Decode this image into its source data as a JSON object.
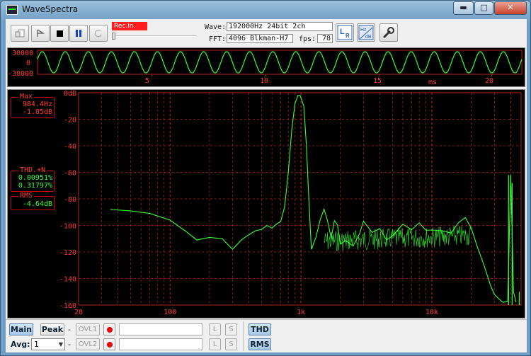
{
  "window": {
    "title": "WaveSpectra",
    "minimize": "▬",
    "maximize": "□",
    "close": "✕"
  },
  "toolbar": {
    "rec_label": "Rec.In.",
    "wave_label": "Wave:",
    "wave_value": "192000Hz 24bit 2ch",
    "fft_label": "FFT:",
    "fft_value": "4096 Blkman-H7",
    "fps_label": "fps:",
    "fps_value": "78",
    "lr_label": "LR",
    "hz_label": "Hz dB"
  },
  "wave": {
    "y_ticks": [
      "30000",
      "0",
      "-30000"
    ],
    "x_ticks": [
      "5",
      "10",
      "15",
      "20"
    ],
    "x_unit": "ms",
    "cycles": 21,
    "line_color": "#38ff38"
  },
  "spectrum": {
    "y_ticks": [
      "0dB",
      "-20",
      "-40",
      "-60",
      "-80",
      "-100",
      "-120",
      "-140",
      "-160"
    ],
    "x_ticks": [
      "20",
      "100",
      "1k",
      "10k"
    ],
    "line_color": "#38ff38",
    "grid_color": "#b22222"
  },
  "readouts": {
    "max_title": "Max",
    "max_freq": "984.4Hz",
    "max_level": "-1.85dB",
    "thd_title": "THD.+N",
    "thd_1": "0.00951%",
    "thd_2": "0.31797%",
    "rms_title": "RMS",
    "rms_value": "-4.64dB"
  },
  "bottom": {
    "main_btn": "Main",
    "peak_btn": "Peak",
    "dash1": "-",
    "ovl1": "OVL1",
    "avg_label": "Avg:",
    "avg_value": "1",
    "dash2": "-",
    "ovl2": "OVL2",
    "l_btn": "L",
    "s_btn": "S",
    "thd_btn": "THD",
    "rms_btn": "RMS"
  },
  "chart_data": [
    {
      "type": "line",
      "x": [
        0,
        1,
        2,
        3,
        4,
        5,
        6,
        7,
        8,
        9,
        10,
        11,
        12,
        13,
        14,
        15,
        16,
        17,
        18,
        19,
        20,
        21
      ],
      "ylim": [
        -30000,
        30000
      ],
      "xlabel": "ms",
      "series": [
        {
          "values": [
            0,
            0,
            0,
            0,
            0,
            0,
            0,
            0,
            0,
            0,
            0,
            0,
            0,
            0,
            0,
            0,
            0,
            0,
            0,
            0,
            0,
            0
          ]
        }
      ],
      "x_ticks": [
        5,
        10,
        15,
        20
      ],
      "y_ticks": [
        30000,
        0,
        -30000
      ]
    },
    {
      "type": "line",
      "xscale": "log",
      "xlim": [
        20,
        48000
      ],
      "ylim": [
        -160,
        0
      ],
      "x_ticks": [
        20,
        100,
        1000,
        10000
      ],
      "y_ticks": [
        0,
        -20,
        -40,
        -60,
        -80,
        -100,
        -120,
        -140,
        -160
      ],
      "x": [
        35,
        50,
        70,
        100,
        130,
        160,
        200,
        250,
        300,
        350,
        400,
        450,
        500,
        550,
        600,
        650,
        700,
        750,
        800,
        850,
        900,
        950,
        984,
        1050,
        1100,
        1150,
        1200,
        1300,
        1400,
        1500,
        1600,
        1700,
        1800,
        1900,
        2000,
        2200,
        2500,
        2800,
        3000,
        3500,
        4000,
        4500,
        5000,
        6000,
        7000,
        8000,
        9000,
        10000,
        12000,
        14000,
        16000,
        18000,
        20000,
        22000,
        25000,
        28000,
        30000,
        33000,
        35000,
        38000,
        40000,
        42000,
        44000
      ],
      "series": [
        {
          "values": [
            -88,
            -89,
            -91,
            -96,
            -104,
            -111,
            -109,
            -110,
            -118,
            -111,
            -107,
            -104,
            -103,
            -100,
            -102,
            -99,
            -97,
            -86,
            -60,
            -28,
            -8,
            -2,
            -2,
            -10,
            -40,
            -82,
            -118,
            -112,
            -95,
            -84,
            -94,
            -110,
            -100,
            -103,
            -114,
            -108,
            -112,
            -106,
            -100,
            -109,
            -103,
            -108,
            -104,
            -98,
            -106,
            -102,
            -105,
            -101,
            -100,
            -104,
            -100,
            -98,
            -102,
            -115,
            -130,
            -145,
            -152,
            -156,
            -158,
            -157,
            -62,
            -150,
            -158
          ]
        }
      ]
    }
  ]
}
